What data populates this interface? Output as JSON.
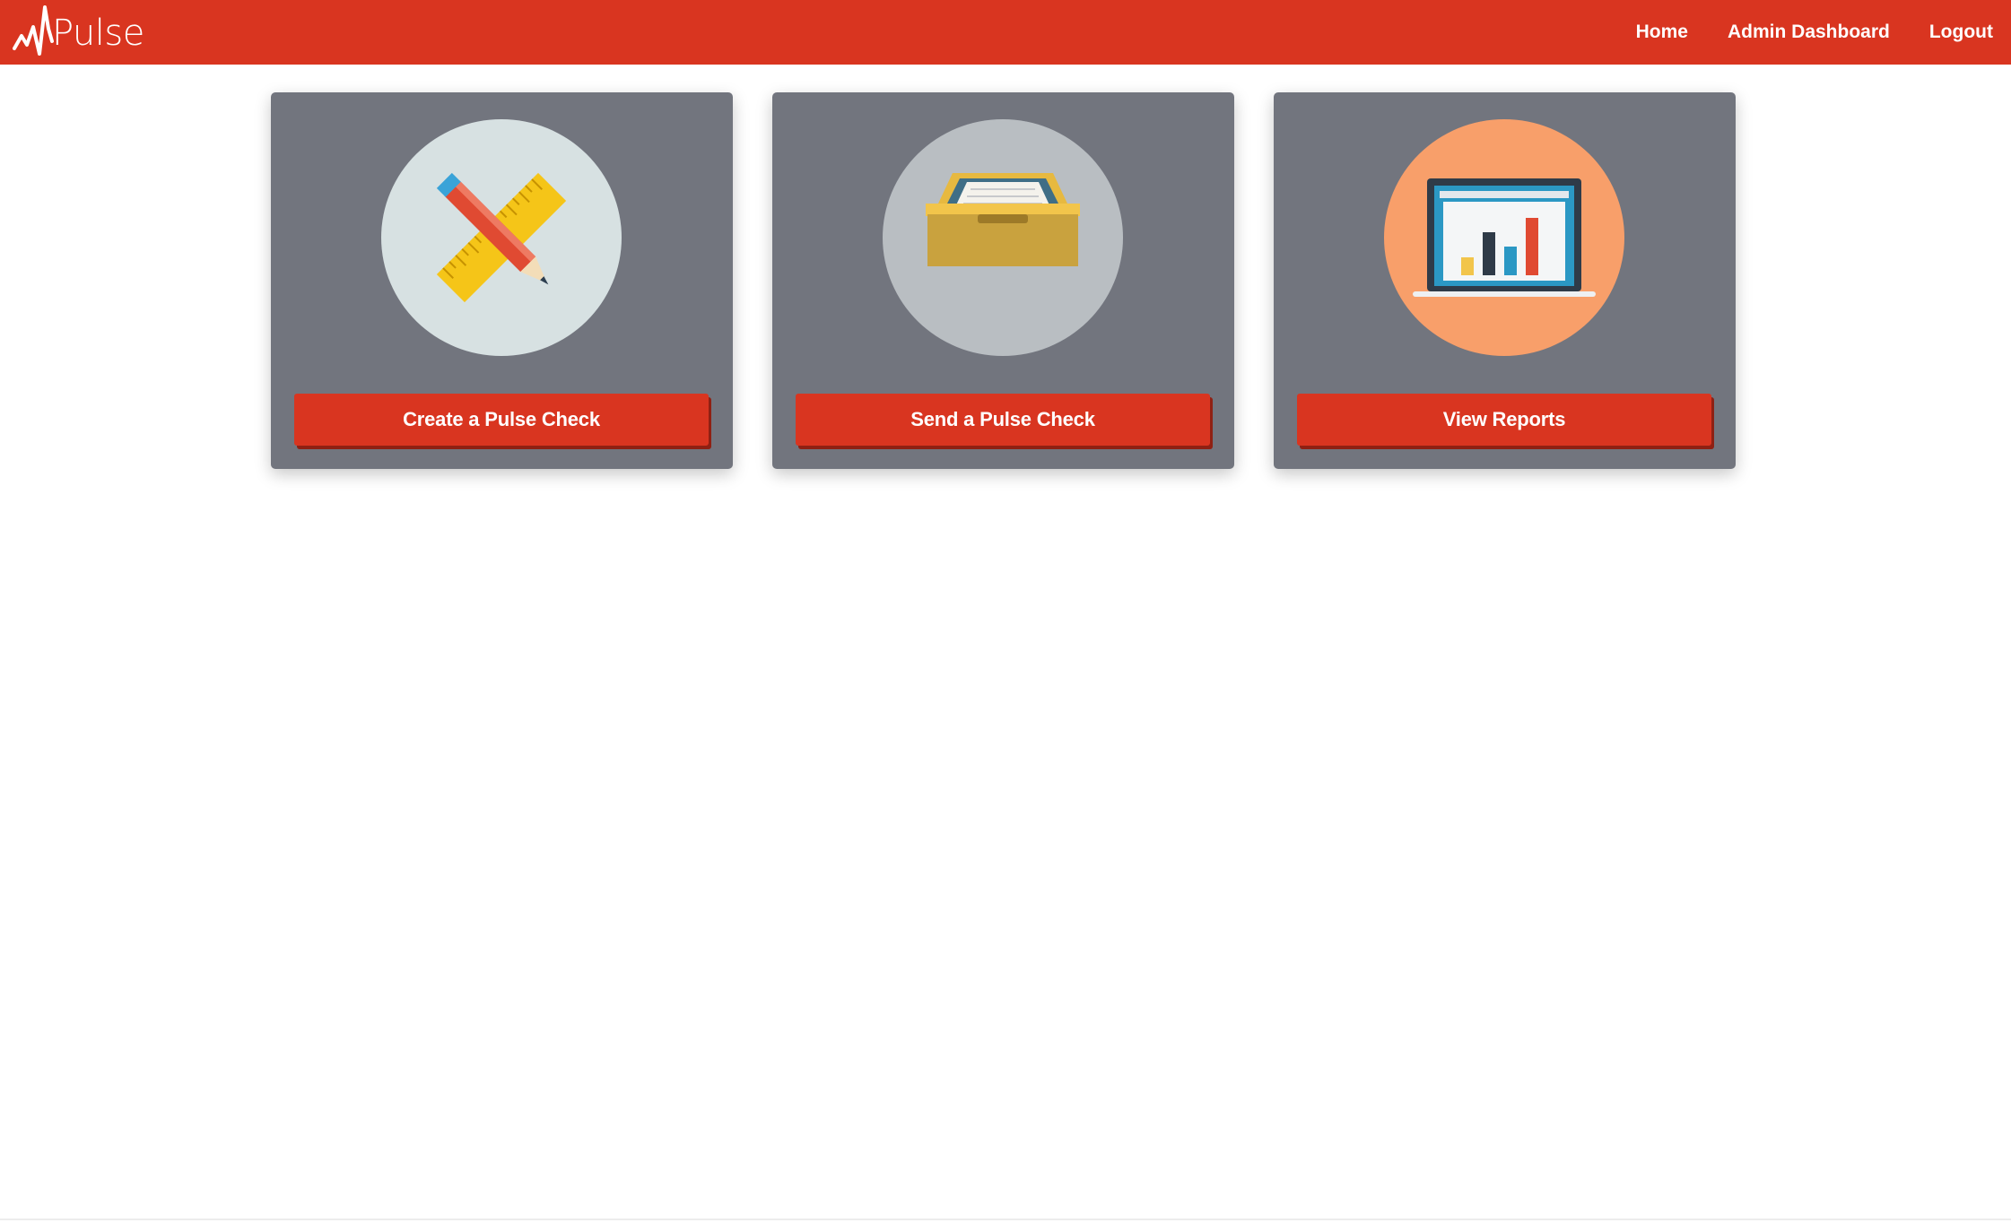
{
  "navbar": {
    "brand": "Pulse",
    "links": [
      {
        "label": "Home"
      },
      {
        "label": "Admin Dashboard"
      },
      {
        "label": "Logout"
      }
    ],
    "color": "#d93520"
  },
  "cards": [
    {
      "button_label": "Create a Pulse Check",
      "icon": "pencil-ruler-icon",
      "circle_color": "#d7e1e2"
    },
    {
      "button_label": "Send a Pulse Check",
      "icon": "inbox-tray-icon",
      "circle_color": "#b9bec2"
    },
    {
      "button_label": "View Reports",
      "icon": "laptop-chart-icon",
      "circle_color": "#f89f6a"
    }
  ],
  "colors": {
    "card_bg": "#72757e",
    "button_bg": "#d93520"
  }
}
